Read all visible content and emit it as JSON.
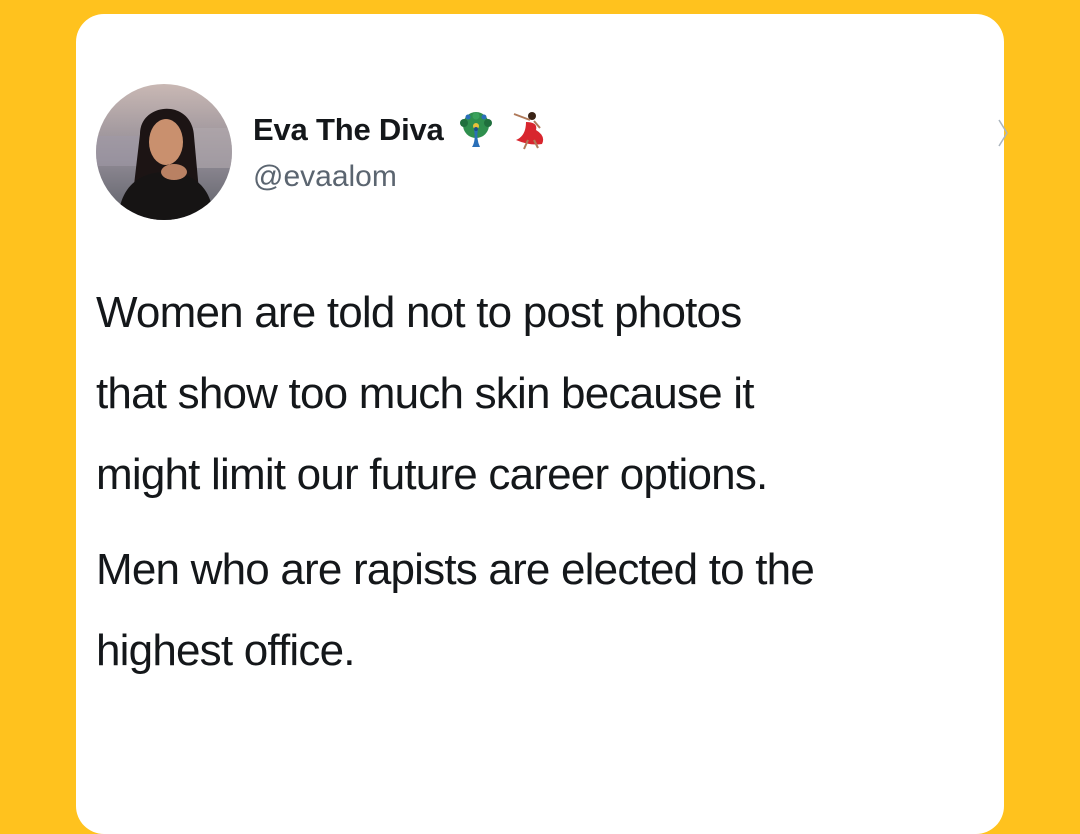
{
  "tweet": {
    "author": {
      "display_name": "Eva The Diva",
      "handle": "@evaalom",
      "name_emojis": [
        "peacock-icon",
        "dancer-icon"
      ]
    },
    "paragraphs": [
      "Women are told not to post photos\nthat show too much skin because it\nmight limit our future career options.",
      "Men who are rapists are elected to the\nhighest office."
    ]
  },
  "colors": {
    "background": "#FFC21E",
    "card": "#FFFFFF",
    "text": "#14171A",
    "secondary_text": "#5B6570"
  }
}
